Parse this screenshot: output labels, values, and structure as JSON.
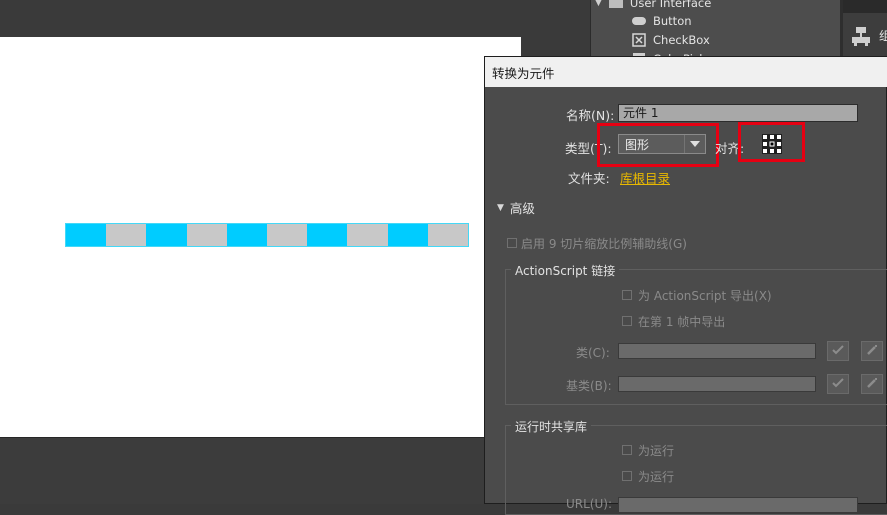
{
  "library": {
    "items": [
      {
        "label": "User Interface",
        "icon": "folder-icon",
        "expanded": true
      },
      {
        "label": "Button",
        "icon": "button-component-icon"
      },
      {
        "label": "CheckBox",
        "icon": "checkbox-component-icon"
      },
      {
        "label": "ColorPicker",
        "icon": "colorpicker-component-icon"
      }
    ]
  },
  "toolbar": {
    "tool_label": "组"
  },
  "dialog": {
    "title": "转换为元件",
    "name_label": "名称(N):",
    "name_value": "元件 1",
    "type_label": "类型(T):",
    "type_value": "图形",
    "align_label": "对齐:",
    "folder_label": "文件夹:",
    "folder_value": "库根目录",
    "advanced_label": "高级",
    "scale9_label": "启用 9 切片缩放比例辅助线(G)",
    "actionscript": {
      "legend": "ActionScript 链接",
      "export_as_label": "为 ActionScript 导出(X)",
      "export_frame_label": "在第 1 帧中导出",
      "class_label": "类(C):",
      "base_class_label": "基类(B):"
    },
    "runtime": {
      "legend": "运行时共享库",
      "export_runtime_label": "为运行",
      "import_runtime_label": "为运行",
      "url_label": "URL(U):"
    }
  },
  "colors": {
    "stage": "#ffffff",
    "dash_cyan": "#00ccff",
    "dash_gray": "#c8c8c8",
    "highlight_red": "#e60012",
    "folder_link": "#e8b800"
  }
}
